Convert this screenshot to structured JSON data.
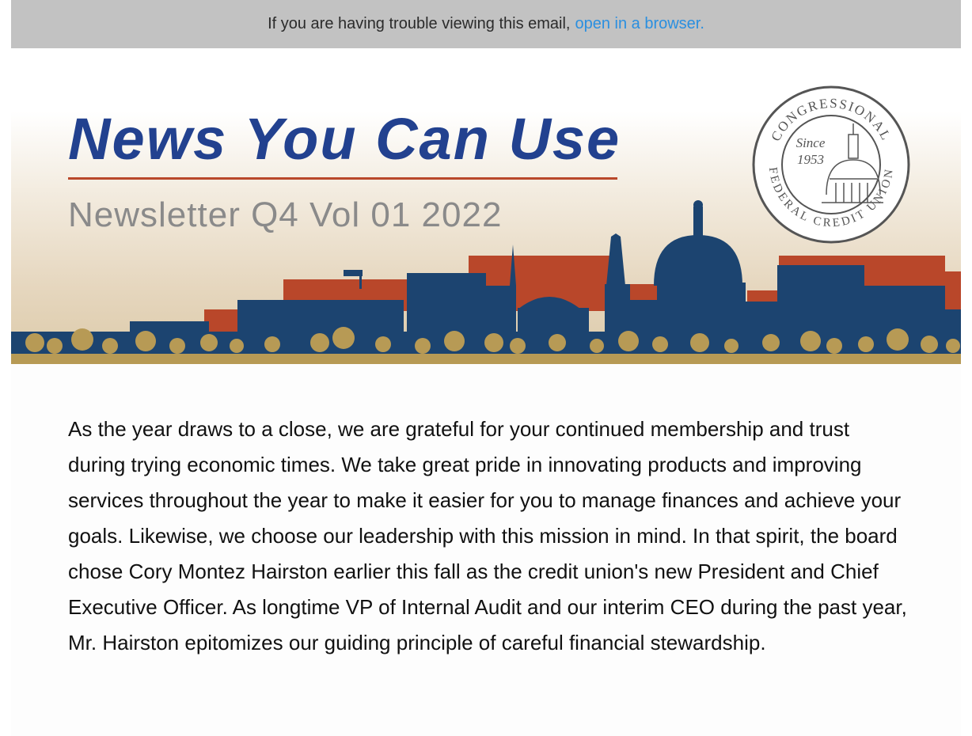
{
  "preheader": {
    "text": "If you are having trouble viewing this email,",
    "link_label": "open in a browser."
  },
  "banner": {
    "title": "News You Can Use",
    "subtitle": "Newsletter Q4 Vol 01 2022",
    "seal": {
      "top_text": "CONGRESSIONAL",
      "bottom_text": "FEDERAL CREDIT UNION",
      "since": "Since",
      "year": "1953"
    }
  },
  "body": {
    "paragraph": "As the year draws to a close, we are grateful for your continued membership and trust during trying economic times. We take great pride in innovating products and improving services throughout the year to make it easier for you to manage finances and achieve your goals. Likewise, we choose our leadership with this mission in mind. In that spirit, the board chose Cory Montez Hairston earlier this fall as the credit union's new President and Chief Executive Officer. As longtime VP of Internal Audit and our interim CEO during the past year, Mr. Hairston epitomizes our guiding principle of careful financial stewardship."
  },
  "colors": {
    "title_blue": "#22418f",
    "rule_red": "#b9472a",
    "skyline_blue": "#1c4470",
    "skyline_red": "#b9472a",
    "ground_gold": "#b79a55",
    "link_blue": "#2a8fe0"
  }
}
